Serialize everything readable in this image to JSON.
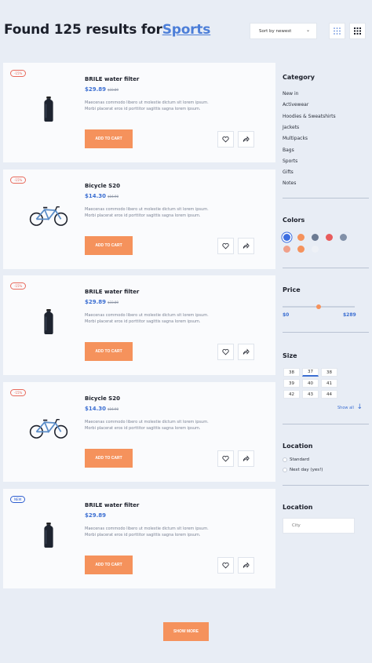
{
  "header": {
    "title_prefix": "Found 125 results for",
    "title_query": "Sports",
    "sort_label": "Sort by newest",
    "grid_view_icon": "grid-dots-icon",
    "compact_view_icon": "grid-compact-icon"
  },
  "products": [
    {
      "badge": "-15%",
      "badge_type": "sale",
      "name": "BRILE water filter",
      "price": "$29.89",
      "old_price": "$33.89",
      "description": "Maecenas commodo libero ut molestie dictum sit lorem ipsum. Morbi placerat eros id porttitor sagittis sagna lorem ipsum.",
      "cart_label": "ADD TO CART",
      "image": "water-bottle"
    },
    {
      "badge": "-15%",
      "badge_type": "sale",
      "name": "Bicycle S20",
      "price": "$14.30",
      "old_price": "$16.90",
      "description": "Maecenas commodo libero ut molestie dictum sit lorem ipsum. Morbi placerat eros id porttitor sagittis sagna lorem ipsum.",
      "cart_label": "ADD TO CART",
      "image": "bicycle"
    },
    {
      "badge": "-15%",
      "badge_type": "sale",
      "name": "BRILE water filter",
      "price": "$29.89",
      "old_price": "$33.89",
      "description": "Maecenas commodo libero ut molestie dictum sit lorem ipsum. Morbi placerat eros id porttitor sagittis sagna lorem ipsum.",
      "cart_label": "ADD TO CART",
      "image": "water-bottle"
    },
    {
      "badge": "-15%",
      "badge_type": "sale",
      "name": "Bicycle S20",
      "price": "$14.30",
      "old_price": "$16.90",
      "description": "Maecenas commodo libero ut molestie dictum sit lorem ipsum. Morbi placerat eros id porttitor sagittis sagna lorem ipsum.",
      "cart_label": "ADD TO CART",
      "image": "bicycle"
    },
    {
      "badge": "NEW",
      "badge_type": "new",
      "name": "BRILE water filter",
      "price": "$29.89",
      "old_price": "",
      "description": "Maecenas commodo libero ut molestie dictum sit lorem ipsum. Morbi placerat eros id porttitor sagittis sagna lorem ipsum.",
      "cart_label": "ADD TO CART",
      "image": "water-bottle"
    }
  ],
  "sidebar": {
    "category_title": "Category",
    "categories": [
      "New in",
      "Activewear",
      "Hoodies & Sweatshirts",
      "Jackets",
      "Multipacks",
      "Bags",
      "Sports",
      "Gifts",
      "Notes"
    ],
    "colors_title": "Colors",
    "colors": [
      "#3d6ee0",
      "#f5925c",
      "#6b7a92",
      "#e85c5c",
      "#8190a8",
      "#f0a08a",
      "#f5925c",
      "#eef1f6"
    ],
    "price_title": "Price",
    "price_min": "$0",
    "price_max": "$289",
    "price_level": 0.5,
    "size_title": "Size",
    "sizes": [
      "38",
      "37",
      "38",
      "39",
      "40",
      "41",
      "42",
      "43",
      "44"
    ],
    "selected_size_index": 1,
    "show_all": "Show all",
    "delivery_title": "Location",
    "delivery_options": [
      "Standard",
      "Next day (yes!)"
    ],
    "location_title": "Location",
    "city_placeholder": "City"
  },
  "footer": {
    "show_more": "SHOW MORE"
  },
  "theme": {
    "accent": "#f5925c",
    "link": "#4c7ed8",
    "sale_badge": "#e86a5c",
    "new_badge": "#2f5fd0"
  }
}
